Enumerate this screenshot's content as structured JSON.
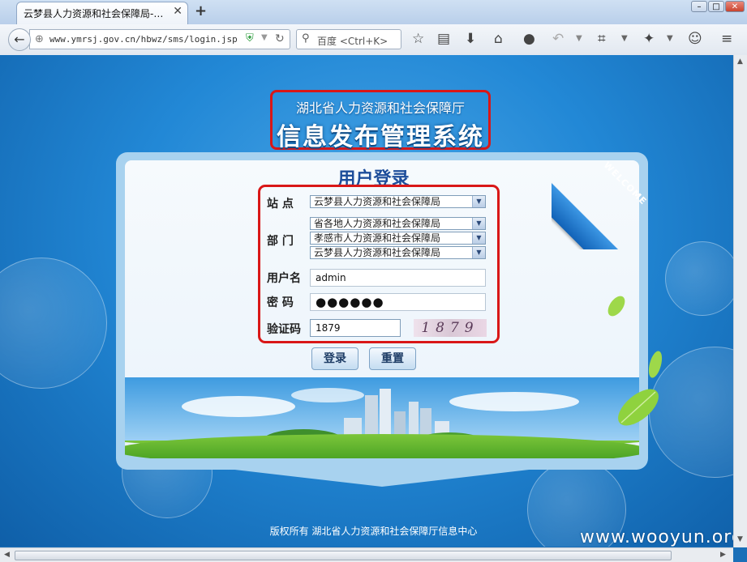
{
  "browser": {
    "tab_title": "云梦县人力资源和社会保障局-…",
    "tab_close": "✕",
    "new_tab": "+",
    "url": "www.ymrsj.gov.cn/hbwz/sms/login.jsp",
    "search_engine": "百度",
    "search_placeholder": "<Ctrl+K>"
  },
  "header": {
    "org": "湖北省人力资源和社会保障厅",
    "system": "信息发布管理系统"
  },
  "login": {
    "heading": "用户登录",
    "ribbon": "WELCOME",
    "site_label": "站 点",
    "site_value": "云梦县人力资源和社会保障局",
    "dept_label": "部 门",
    "dept_level1": "省各地人力资源和社会保障局",
    "dept_level2": "孝感市人力资源和社会保障局",
    "dept_level3": "云梦县人力资源和社会保障局",
    "user_label": "用户名",
    "user_value": "admin",
    "pass_label": "密 码",
    "pass_value": "●●●●●●",
    "code_label": "验证码",
    "code_value": "1879",
    "captcha_text": "1879",
    "login_button": "登录",
    "reset_button": "重置"
  },
  "footer": {
    "copyright": "版权所有 湖北省人力资源和社会保障厅信息中心",
    "watermark": "www.wooyun.org"
  }
}
